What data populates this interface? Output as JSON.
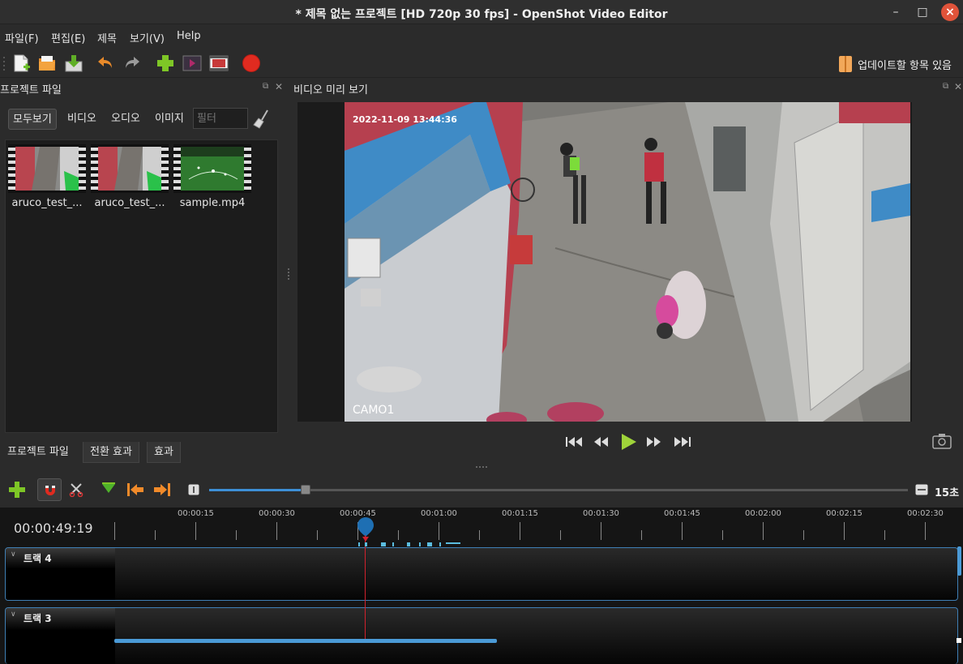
{
  "window": {
    "title": "* 제목 없는 프로젝트 [HD 720p 30 fps] - OpenShot Video Editor",
    "minimize": "–",
    "maximize": "□",
    "close": "×"
  },
  "menu": {
    "file": "파일(F)",
    "edit": "편집(E)",
    "title": "제목",
    "view": "보기(V)",
    "help": "Help"
  },
  "toolbar": {
    "icons": [
      "new-project-icon",
      "open-project-icon",
      "save-project-icon",
      "undo-icon",
      "redo-icon",
      "import-files-icon",
      "profile-icon",
      "fullscreen-icon",
      "export-video-icon"
    ],
    "update_label": "업데이트할 항목 있음"
  },
  "project_files": {
    "title": "프로젝트 파일",
    "filters": {
      "all": "모두보기",
      "video": "비디오",
      "audio": "오디오",
      "image": "이미지"
    },
    "filter_placeholder": "필터",
    "files": [
      {
        "label": "aruco_test_..."
      },
      {
        "label": "aruco_test_..."
      },
      {
        "label": "sample.mp4"
      }
    ]
  },
  "bottom_tabs": {
    "project_files": "프로젝트 파일",
    "transitions": "전환 효과",
    "effects": "효과"
  },
  "preview": {
    "title": "비디오 미리 보기",
    "osd_timestamp": "2022-11-09 13:44:36",
    "osd_camera": "CAMO1"
  },
  "playback": {
    "icons": [
      "jump-start-icon",
      "rewind-icon",
      "play-icon",
      "fast-forward-icon",
      "jump-end-icon"
    ]
  },
  "timeline_toolbar": {
    "zoom_value": "15초",
    "zoom_level": 0.14
  },
  "timeline": {
    "timecode": "00:00:49:19",
    "ticks": [
      "00:00:15",
      "00:00:30",
      "00:00:45",
      "00:01:00",
      "00:01:15",
      "00:01:30",
      "00:01:45",
      "00:02:00",
      "00:02:15",
      "00:02:30"
    ],
    "tracks": [
      {
        "name": "트랙 4"
      },
      {
        "name": "트랙 3"
      }
    ]
  },
  "colors": {
    "accent": "#3d8fd6",
    "playhead": "#d2212d",
    "record": "#e02b20",
    "add": "#7ec626"
  }
}
